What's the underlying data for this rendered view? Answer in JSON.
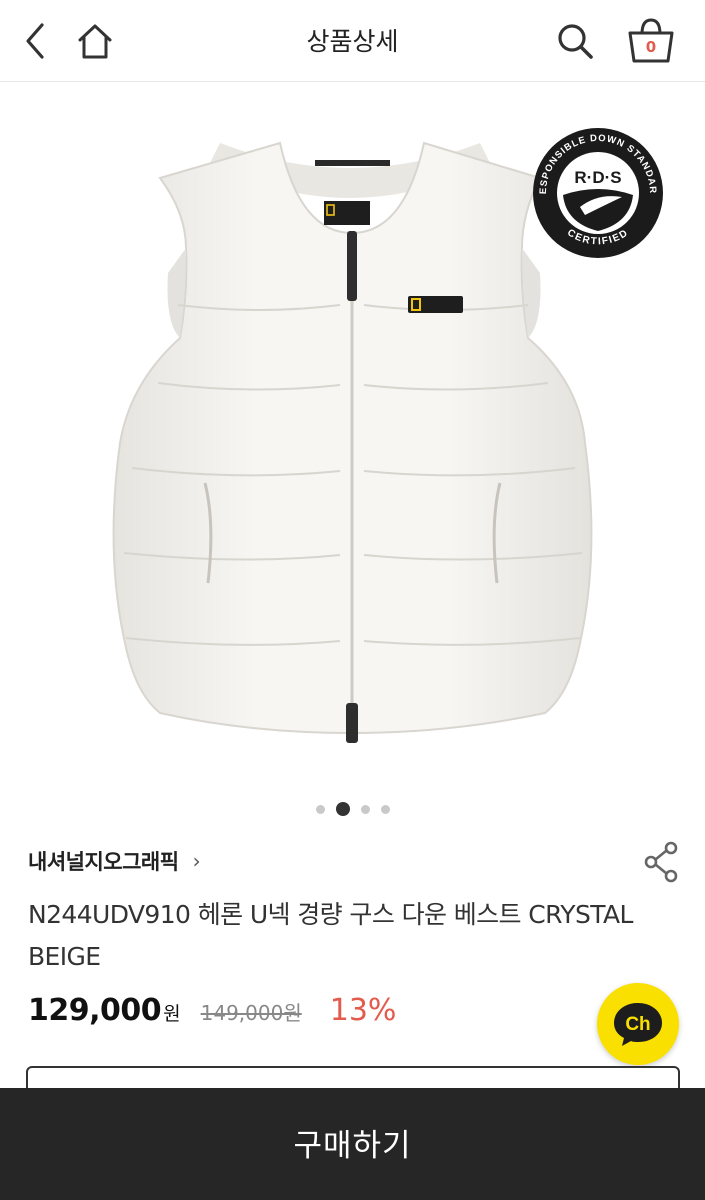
{
  "header": {
    "title": "상품상세",
    "cart_count": "0",
    "icons": {
      "back": "chevron-left-icon",
      "home": "home-icon",
      "search": "search-icon",
      "cart": "basket-icon"
    }
  },
  "gallery": {
    "rds_badge": {
      "top_text": "RESPONSIBLE DOWN STANDARD",
      "center_text": "R·D·S",
      "bottom_text": "CERTIFIED"
    },
    "dots_count": 4,
    "active_index": 1
  },
  "product": {
    "brand": "내셔널지오그래픽",
    "brand_chevron": "›",
    "name": "N244UDV910 헤론 U넥 경량 구스 다운 베스트 CRYSTAL BEIGE",
    "price": "129,000",
    "price_unit": "원",
    "original_price": "149,000원",
    "discount": "13%"
  },
  "chat": {
    "label": "Ch",
    "color": "#f9e000"
  },
  "buy_bar": {
    "label": "구매하기",
    "color": "#262626"
  },
  "colors": {
    "accent_red": "#e35b4c",
    "text_dark": "#222222"
  }
}
